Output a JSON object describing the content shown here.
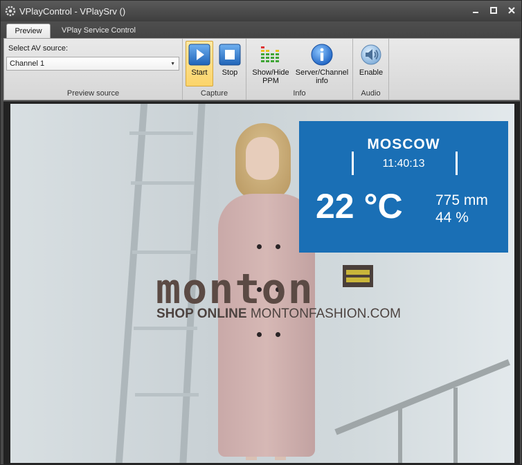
{
  "window": {
    "title": "VPlayControl - VPlaySrv ()",
    "controls": {
      "minimize": "▬",
      "maximize": "◼",
      "close": "✖"
    }
  },
  "tabs": [
    {
      "label": "Preview",
      "active": true
    },
    {
      "label": "VPlay Service Control",
      "active": false
    }
  ],
  "ribbon": {
    "preview_source": {
      "label": "Select AV source:",
      "selected": "Channel 1",
      "group_label": "Preview source"
    },
    "capture": {
      "start_label": "Start",
      "stop_label": "Stop",
      "group_label": "Capture",
      "start_pressed": true
    },
    "info": {
      "ppm_label_1": "Show/Hide",
      "ppm_label_2": "PPM",
      "server_label_1": "Server/Channel",
      "server_label_2": "info",
      "group_label": "Info"
    },
    "audio": {
      "enable_label": "Enable",
      "group_label": "Audio"
    }
  },
  "preview": {
    "weather": {
      "city": "MOSCOW",
      "time": "11:40:13",
      "temperature": "22 °C",
      "pressure": "775 mm",
      "humidity": "44 %"
    },
    "ad": {
      "brand": "monton",
      "shop_bold": "SHOP ONLINE",
      "shop_site": "MONTONFASHION.COM"
    }
  },
  "colors": {
    "weather_bg": "#1a6fb5",
    "ribbon_bg": "#e2e2e2",
    "titlebar_bg": "#4a4a4a",
    "pressed_button": "#fbd46a"
  },
  "icons": {
    "app": "app-gear-icon",
    "start": "play-icon",
    "stop": "stop-icon",
    "ppm": "level-meter-icon",
    "info": "info-icon",
    "audio": "speaker-icon"
  }
}
